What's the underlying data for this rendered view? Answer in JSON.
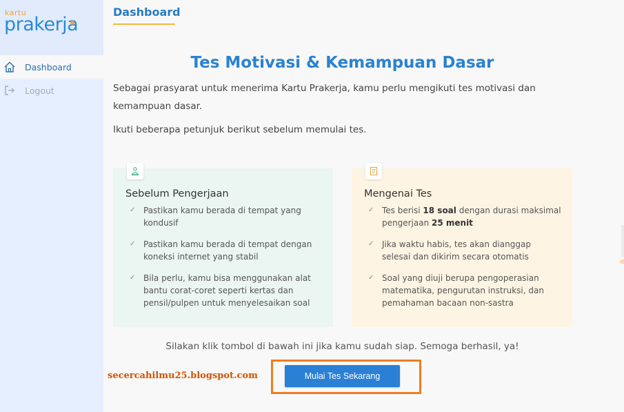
{
  "brand": {
    "small": "kartu",
    "big": "prakerja"
  },
  "sidebar": {
    "items": [
      {
        "label": "Dashboard",
        "icon": "home-icon",
        "active": true
      },
      {
        "label": "Logout",
        "icon": "logout-icon",
        "active": false
      }
    ]
  },
  "header": {
    "title": "Dashboard"
  },
  "main": {
    "title": "Tes Motivasi & Kemampuan Dasar",
    "intro": "Sebagai prasyarat untuk menerima Kartu Prakerja, kamu perlu mengikuti tes motivasi dan kemampuan dasar.",
    "instruction": "Ikuti beberapa petunjuk berikut sebelum memulai tes.",
    "cards": [
      {
        "title": "Sebelum Pengerjaan",
        "icon": "person-icon",
        "items": [
          "Pastikan kamu berada di tempat yang kondusif",
          "Pastikan kamu berada di tempat dengan koneksi internet yang stabil",
          "Bila perlu, kamu bisa menggunakan alat bantu corat-coret seperti kertas dan pensil/pulpen untuk menyelesaikan soal"
        ]
      },
      {
        "title": "Mengenai Tes",
        "icon": "document-icon",
        "items": [
          {
            "p1": "Tes berisi ",
            "b1": "18 soal",
            "p2": " dengan durasi maksimal pengerjaan ",
            "b2": "25 menit"
          },
          "Jika waktu habis, tes akan dianggap selesai dan dikirim secara otomatis",
          "Soal yang diuji berupa pengoperasian matematika, pengurutan instruksi, dan pemahaman bacaan non-sastra"
        ]
      }
    ],
    "bottom_text": "Silakan klik tombol di bawah ini jika kamu sudah siap. Semoga berhasil, ya!",
    "start_button": "Mulai Tes Sekarang",
    "watermark": "secercahilmu25.blogspot.com"
  },
  "colors": {
    "accent": "#2a80d4",
    "brand_orange": "#f3a23c",
    "highlight": "#ee7d1f",
    "card_left_bg": "#ebf5f1",
    "card_right_bg": "#fdf4e3"
  }
}
